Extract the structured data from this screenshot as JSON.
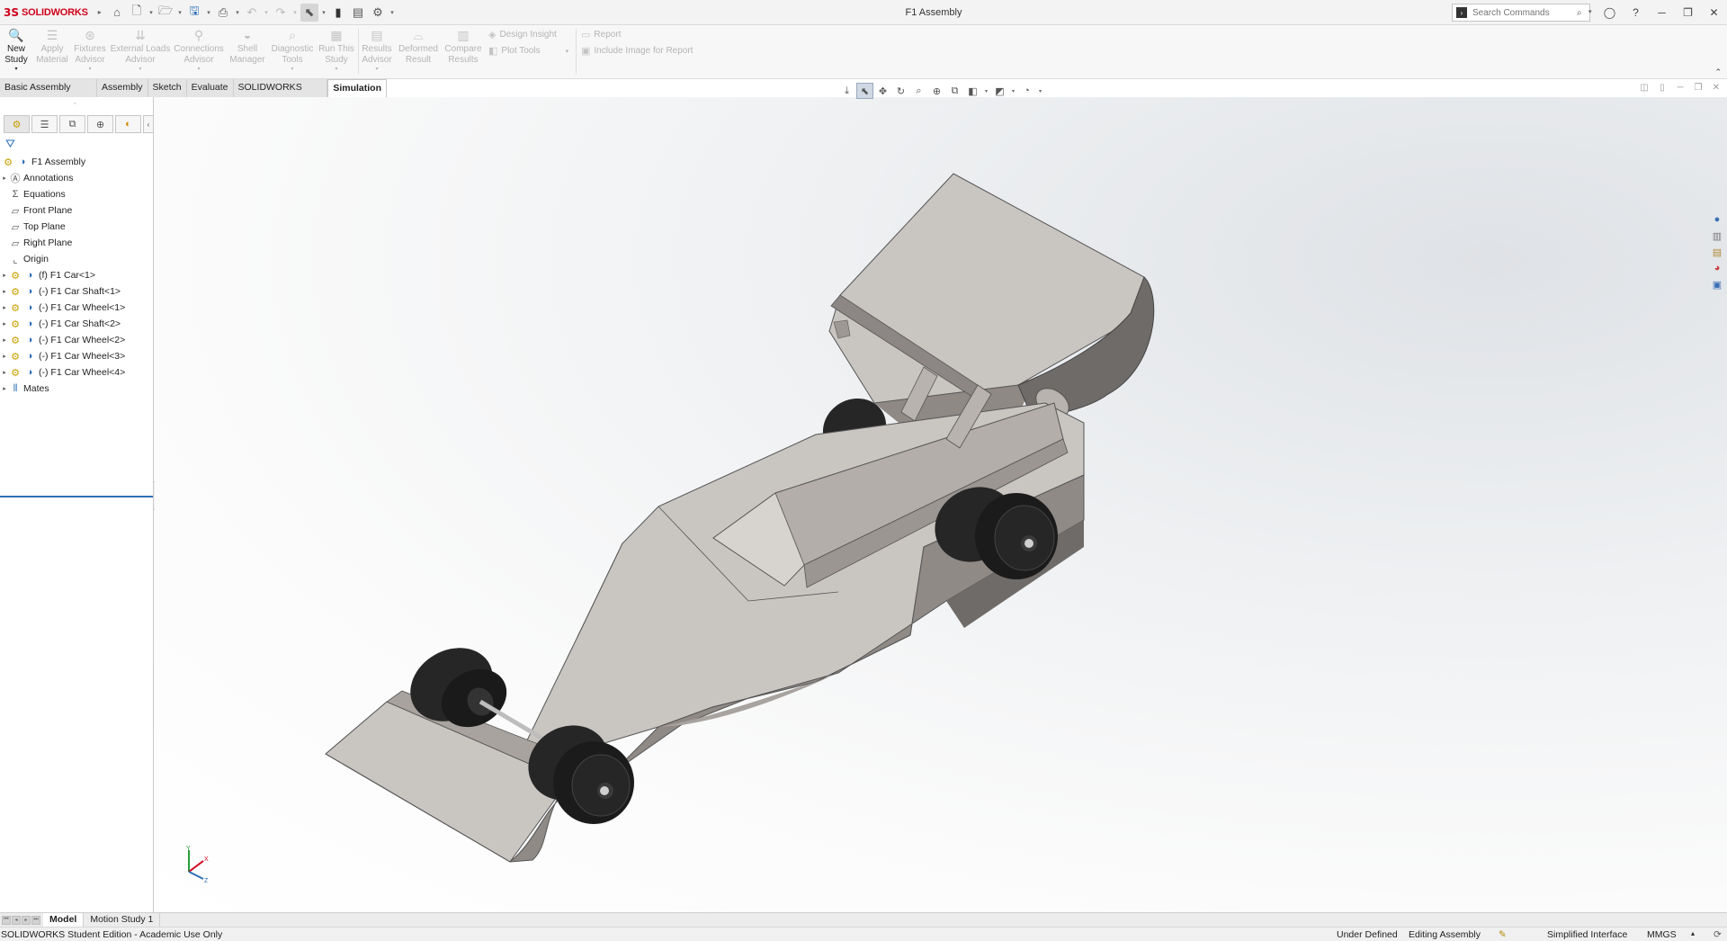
{
  "app": {
    "brand": "SOLIDWORKS",
    "brand_mark": "3S",
    "document_title": "F1 Assembly"
  },
  "quick_access": {
    "icons": [
      "home-icon",
      "new-document-icon",
      "open-icon",
      "save-icon",
      "print-icon",
      "undo-icon",
      "redo-icon",
      "select-icon",
      "rebuild-icon",
      "file-properties-icon",
      "options-icon"
    ]
  },
  "search": {
    "placeholder": "Search Commands"
  },
  "command_manager": {
    "buttons": [
      {
        "label_1": "New",
        "label_2": "Study",
        "icon": "new-study-icon",
        "enabled": true
      },
      {
        "label_1": "Apply",
        "label_2": "Material",
        "icon": "apply-material-icon",
        "enabled": false
      },
      {
        "label_1": "Fixtures",
        "label_2": "Advisor",
        "icon": "fixtures-advisor-icon",
        "enabled": false
      },
      {
        "label_1": "External Loads",
        "label_2": "Advisor",
        "icon": "external-loads-icon",
        "enabled": false
      },
      {
        "label_1": "Connections",
        "label_2": "Advisor",
        "icon": "connections-advisor-icon",
        "enabled": false
      },
      {
        "label_1": "Shell",
        "label_2": "Manager",
        "icon": "shell-manager-icon",
        "enabled": false
      },
      {
        "label_1": "Diagnostic",
        "label_2": "Tools",
        "icon": "diagnostic-tools-icon",
        "enabled": false
      },
      {
        "label_1": "Run This",
        "label_2": "Study",
        "icon": "run-study-icon",
        "enabled": false
      },
      {
        "label_1": "Results",
        "label_2": "Advisor",
        "icon": "results-advisor-icon",
        "enabled": false
      },
      {
        "label_1": "Deformed",
        "label_2": "Result",
        "icon": "deformed-result-icon",
        "enabled": false
      },
      {
        "label_1": "Compare",
        "label_2": "Results",
        "icon": "compare-results-icon",
        "enabled": false
      }
    ],
    "small": {
      "design_insight": "Design Insight",
      "plot_tools": "Plot Tools",
      "report": "Report",
      "include_image": "Include Image for Report"
    }
  },
  "tabs": [
    {
      "label": "Basic Assembly Tools",
      "active": false
    },
    {
      "label": "Assembly",
      "active": false
    },
    {
      "label": "Sketch",
      "active": false
    },
    {
      "label": "Evaluate",
      "active": false
    },
    {
      "label": "SOLIDWORKS CAM",
      "active": false
    },
    {
      "label": "Simulation",
      "active": true
    }
  ],
  "feature_tree": {
    "root": "F1 Assembly",
    "items": [
      {
        "label": "Annotations",
        "icon": "annotations-icon",
        "expandable": true
      },
      {
        "label": "Equations",
        "icon": "equations-icon",
        "expandable": false
      },
      {
        "label": "Front Plane",
        "icon": "plane-icon",
        "expandable": false
      },
      {
        "label": "Top Plane",
        "icon": "plane-icon",
        "expandable": false
      },
      {
        "label": "Right Plane",
        "icon": "plane-icon",
        "expandable": false
      },
      {
        "label": "Origin",
        "icon": "origin-icon",
        "expandable": false
      },
      {
        "label": "(f) F1 Car<1>",
        "icon": "part-icon",
        "expandable": true
      },
      {
        "label": "(-) F1 Car Shaft<1>",
        "icon": "part-icon",
        "expandable": true
      },
      {
        "label": "(-) F1 Car Wheel<1>",
        "icon": "part-icon",
        "expandable": true
      },
      {
        "label": "(-) F1 Car Shaft<2>",
        "icon": "part-icon",
        "expandable": true
      },
      {
        "label": "(-) F1 Car Wheel<2>",
        "icon": "part-icon",
        "expandable": true
      },
      {
        "label": "(-) F1 Car Wheel<3>",
        "icon": "part-icon",
        "expandable": true
      },
      {
        "label": "(-) F1 Car Wheel<4>",
        "icon": "part-icon",
        "expandable": true
      },
      {
        "label": "Mates",
        "icon": "mates-icon",
        "expandable": true
      }
    ]
  },
  "bottom_tabs": [
    {
      "label": "Model",
      "active": true
    },
    {
      "label": "Motion Study 1",
      "active": false
    }
  ],
  "status_bar": {
    "edition": "SOLIDWORKS Student Edition - Academic Use Only",
    "state": "Under Defined",
    "mode": "Editing Assembly",
    "interface": "Simplified Interface",
    "units": "MMGS"
  },
  "triad": {
    "x_label": "X",
    "y_label": "Y",
    "z_label": "Z"
  },
  "colors": {
    "brand_red": "#d0021b",
    "accent_blue": "#2d6fb7",
    "body_light": "#c9c5c1",
    "body_mid": "#a9a4a0",
    "body_dark": "#6f6b68",
    "wheel": "#262626"
  }
}
